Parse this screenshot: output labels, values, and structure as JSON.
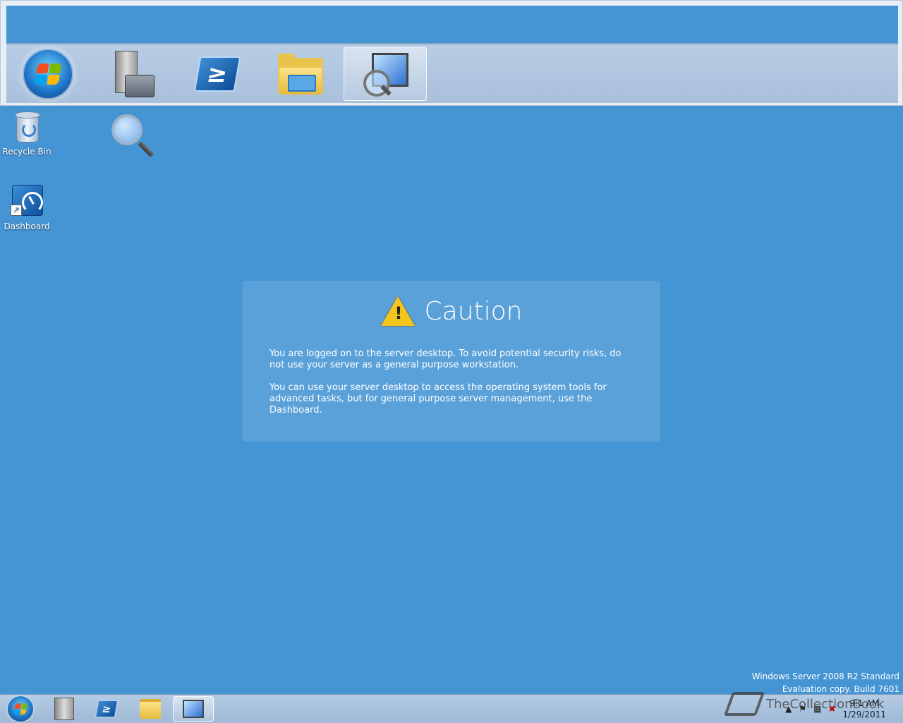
{
  "desktop": {
    "icons": [
      {
        "label": "Recycle Bin"
      },
      {
        "label": "Dashboard"
      }
    ]
  },
  "caution": {
    "title": "Caution",
    "paragraph1": "You are logged on to the server desktop. To avoid potential security risks, do not use your server as a general purpose workstation.",
    "paragraph2": "You can use your server desktop to access the operating system tools for advanced tasks, but for general purpose server management, use the Dashboard."
  },
  "watermark": {
    "line1": "Windows Server 2008 R2 Standard",
    "line2": "Evaluation copy. Build 7601"
  },
  "taskbar": {
    "powershell_glyph": "≥",
    "clock_time": "9:1 AM",
    "clock_date": "1/29/2011"
  },
  "overlay": {
    "text": "TheCollectionBook"
  },
  "colors": {
    "desktop": "#4594d4",
    "taskbar": "#a9c0dc",
    "warning": "#f3c51d"
  },
  "icons": [
    "start-orb-icon",
    "server-manager-icon",
    "powershell-icon",
    "explorer-folder-icon",
    "magnifier-icon",
    "recycle-bin-icon",
    "dashboard-icon",
    "warning-icon"
  ]
}
